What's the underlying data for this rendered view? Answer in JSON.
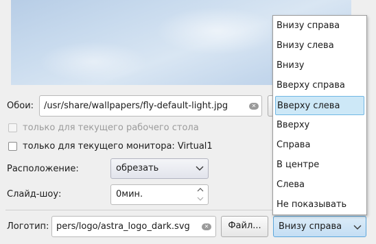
{
  "wallpaper": {
    "label": "Обои:",
    "path": "/usr/share/wallpapers/fly-default-light.jpg",
    "clear_icon": "clear-x-icon"
  },
  "options": {
    "current_desktop_only": "только для текущего рабочего стола",
    "current_desktop_only_checked": false,
    "current_desktop_only_enabled": false,
    "current_monitor_only": "только для текущего монитора: Virtual1",
    "current_monitor_only_checked": false
  },
  "placement": {
    "label": "Расположение:",
    "value": "обрезать"
  },
  "slideshow": {
    "label": "Слайд-шоу:",
    "value": "0мин."
  },
  "logo": {
    "label": "Логотип:",
    "path": "pers/logo/astra_logo_dark.svg",
    "file_button": "Файл...",
    "position_value": "Внизу справа"
  },
  "logo_position_dropdown": {
    "items": [
      "Внизу справа",
      "Внизу слева",
      "Внизу",
      "Вверху справа",
      "Вверху слева",
      "Вверху",
      "Справа",
      "В центре",
      "Слева",
      "Не показывать"
    ],
    "highlighted_index": 4
  },
  "colors": {
    "highlight_bg": "#cde8f7",
    "highlight_border": "#6fb6e3",
    "combo_active_border": "#5aa5da"
  }
}
